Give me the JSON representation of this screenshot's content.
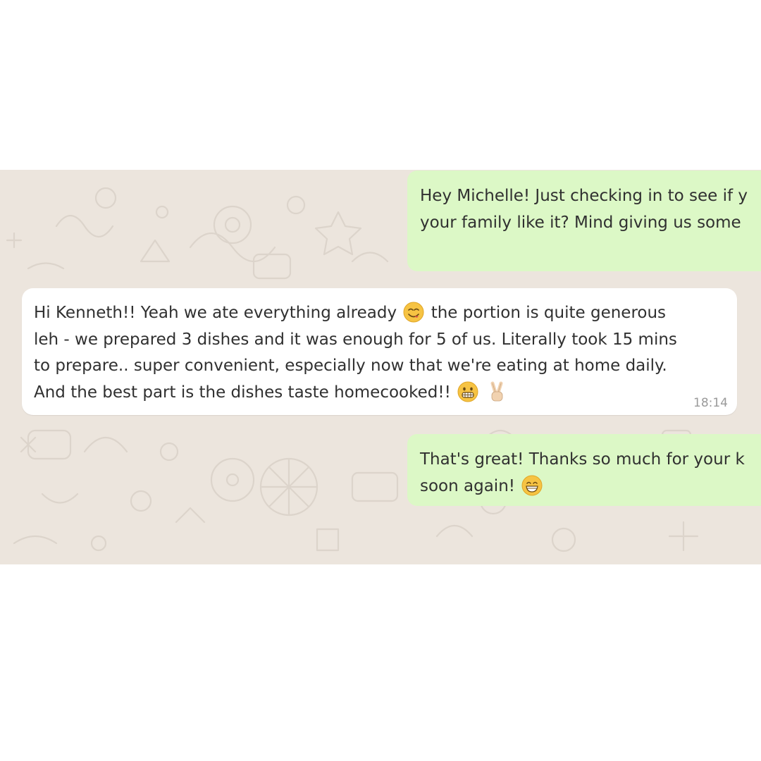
{
  "chat": {
    "wallpaper_color": "#ece5dd",
    "outgoing_color": "#dcf8c6",
    "incoming_color": "#ffffff",
    "messages": [
      {
        "direction": "outgoing",
        "lines": [
          "Hey Michelle! Just checking in to see if y",
          "your family like it? Mind giving us some"
        ]
      },
      {
        "direction": "incoming",
        "lines": [
          "Hi Kenneth!! Yeah we ate everything already",
          "the portion is quite generous",
          "leh - we prepared 3 dishes and it was enough for 5 of us. Literally took 15 mins",
          "to prepare.. super convenient, especially now that we're eating at home daily.",
          "And the best part is the dishes taste homecooked!!"
        ],
        "emojis": [
          "yum-face-emoji",
          "grimacing-face-emoji",
          "victory-hand-emoji"
        ],
        "time": "18:14"
      },
      {
        "direction": "outgoing",
        "lines": [
          "That's great! Thanks so much for your k",
          "soon again!"
        ],
        "emojis": [
          "grinning-face-emoji"
        ]
      }
    ]
  }
}
